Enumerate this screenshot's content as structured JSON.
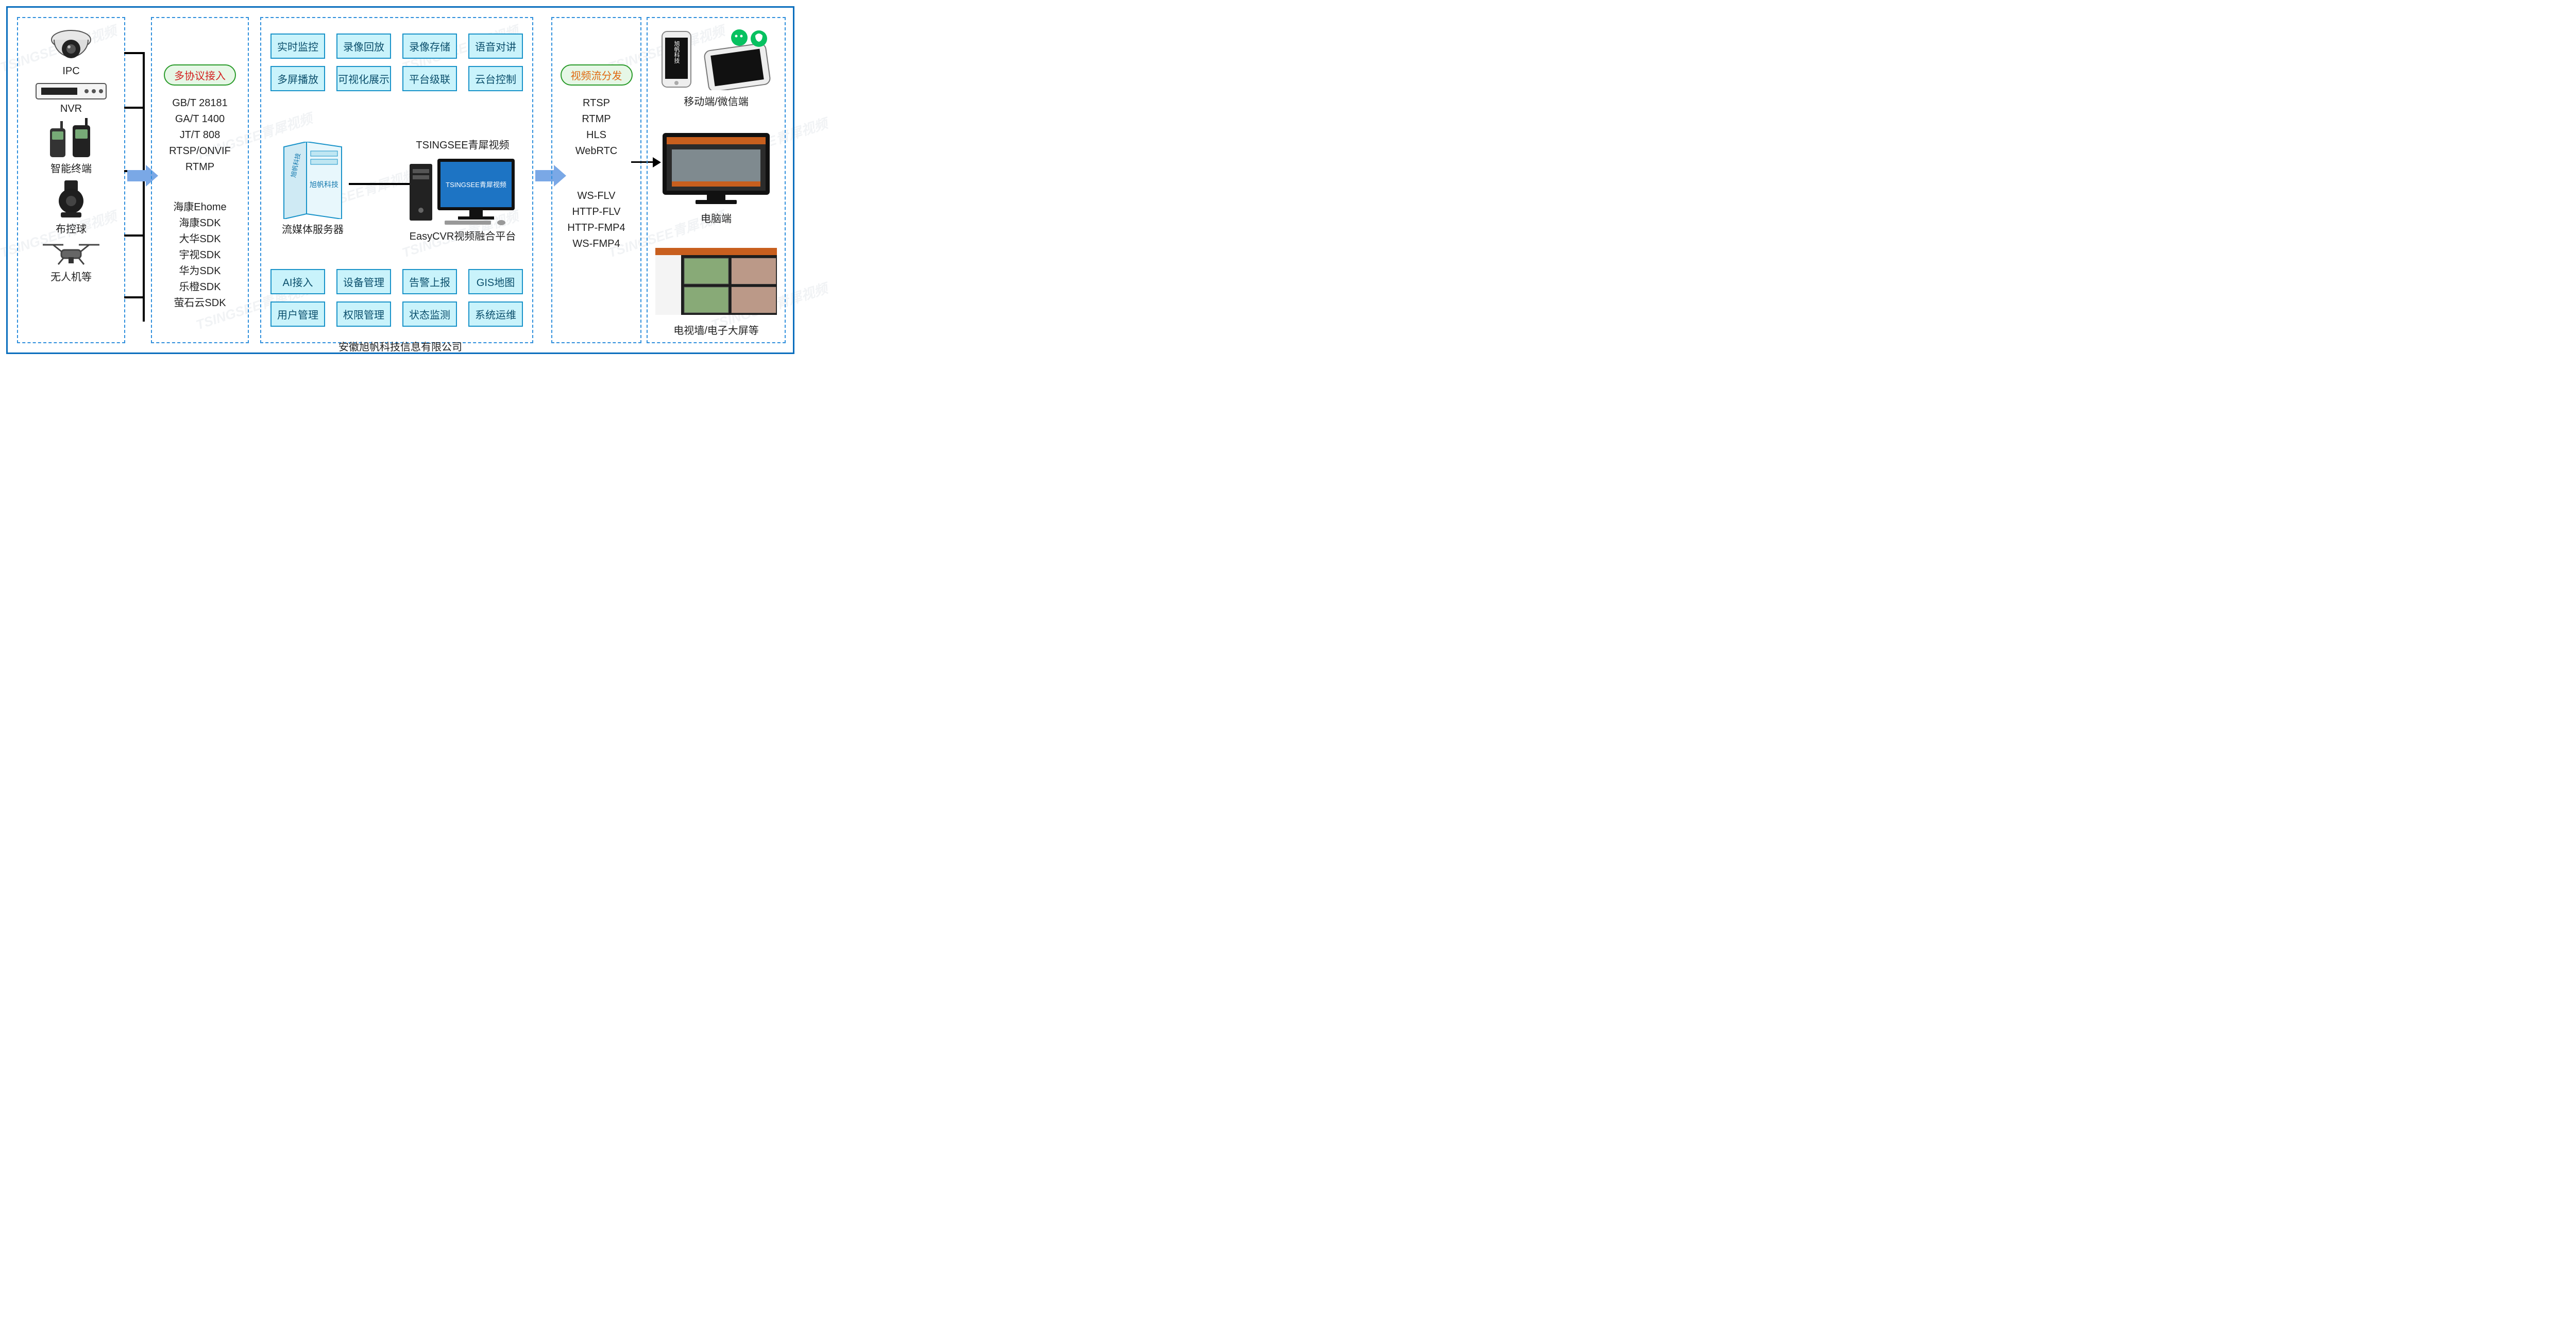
{
  "watermark_text": "TSINGSEE青犀视频",
  "left_devices": [
    {
      "id": "ipc",
      "label": "IPC"
    },
    {
      "id": "nvr",
      "label": "NVR"
    },
    {
      "id": "term",
      "label": "智能终端"
    },
    {
      "id": "ball",
      "label": "布控球"
    },
    {
      "id": "uav",
      "label": "无人机等"
    }
  ],
  "protocol_panel": {
    "pill": "多协议接入",
    "standards": [
      "GB/T 28181",
      "GA/T 1400",
      "JT/T 808",
      "RTSP/ONVIF",
      "RTMP"
    ],
    "sdks": [
      "海康Ehome",
      "海康SDK",
      "大华SDK",
      "宇视SDK",
      "华为SDK",
      "乐橙SDK",
      "萤石云SDK"
    ]
  },
  "center": {
    "tiles_top": [
      "实时监控",
      "录像回放",
      "录像存储",
      "语音对讲",
      "多屏播放",
      "可视化展示",
      "平台级联",
      "云台控制"
    ],
    "server_side_text": "旭帆科技",
    "server_front_text": "旭帆科技",
    "server_label": "流媒体服务器",
    "pc_brand": "TSINGSEE青犀视频",
    "pc_screen_text": "TSINGSEE青犀视频",
    "pc_label": "EasyCVR视频融合平台",
    "tiles_bot": [
      "AI接入",
      "设备管理",
      "告警上报",
      "GIS地图",
      "用户管理",
      "权限管理",
      "状态监测",
      "系统运维"
    ]
  },
  "distribution_panel": {
    "pill": "视频流分发",
    "group_a": [
      "RTSP",
      "RTMP",
      "HLS",
      "WebRTC"
    ],
    "group_b": [
      "WS-FLV",
      "HTTP-FLV",
      "HTTP-FMP4",
      "WS-FMP4"
    ]
  },
  "right_clients": [
    {
      "id": "mobile",
      "label": "移动端/微信端"
    },
    {
      "id": "pc",
      "label": "电脑端"
    },
    {
      "id": "wall",
      "label": "电视墙/电子大屏等"
    }
  ],
  "phone_side_text": "旭帆科技",
  "company": "安徽旭帆科技信息有限公司"
}
